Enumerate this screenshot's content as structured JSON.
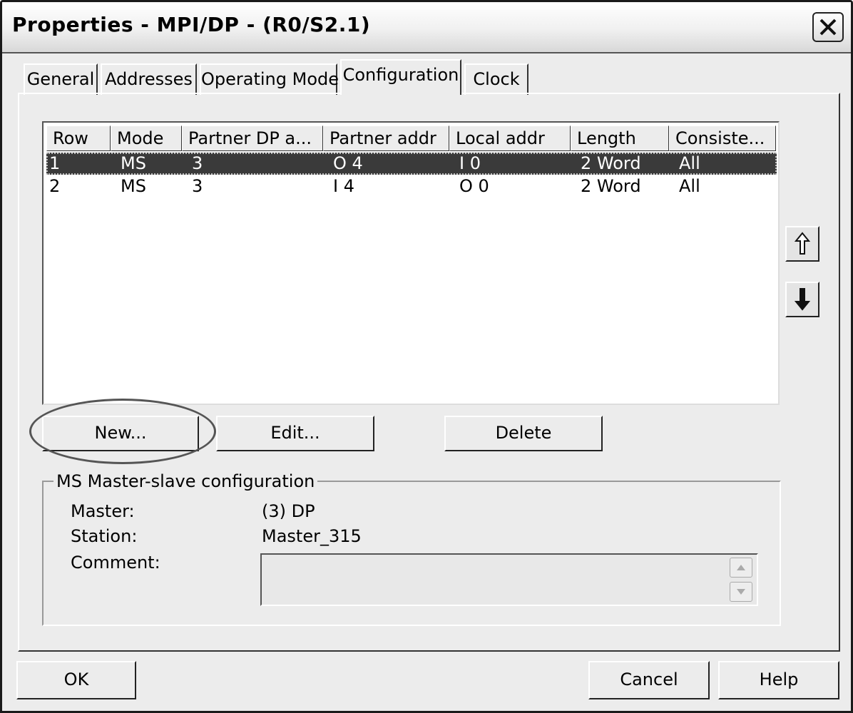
{
  "window": {
    "title": "Properties - MPI/DP - (R0/S2.1)",
    "close_icon": "close-icon"
  },
  "tabs": [
    {
      "label": "General",
      "active": false
    },
    {
      "label": "Addresses",
      "active": false
    },
    {
      "label": "Operating Mode",
      "active": false
    },
    {
      "label": "Configuration",
      "active": true
    },
    {
      "label": "Clock",
      "active": false
    }
  ],
  "table": {
    "columns": [
      "Row",
      "Mode",
      "Partner DP a...",
      "Partner addr",
      "Local addr",
      "Length",
      "Consiste..."
    ],
    "rows": [
      {
        "row": "1",
        "mode": "MS",
        "partner_dp": "3",
        "partner_addr": "O 4",
        "local_addr": "I 0",
        "length": "2 Word",
        "consistency": "All",
        "selected": true
      },
      {
        "row": "2",
        "mode": "MS",
        "partner_dp": "3",
        "partner_addr": "I 4",
        "local_addr": "O 0",
        "length": "2 Word",
        "consistency": "All",
        "selected": false
      }
    ]
  },
  "side_buttons": {
    "up_icon": "arrow-up-icon",
    "down_icon": "arrow-down-icon"
  },
  "actions": {
    "new": "New...",
    "edit": "Edit...",
    "delete": "Delete"
  },
  "details": {
    "legend": "MS Master-slave configuration",
    "master_label": "Master:",
    "master_value": "(3) DP",
    "station_label": "Station:",
    "station_value": "Master_315",
    "comment_label": "Comment:",
    "comment_value": ""
  },
  "footer": {
    "ok": "OK",
    "cancel": "Cancel",
    "help": "Help"
  }
}
